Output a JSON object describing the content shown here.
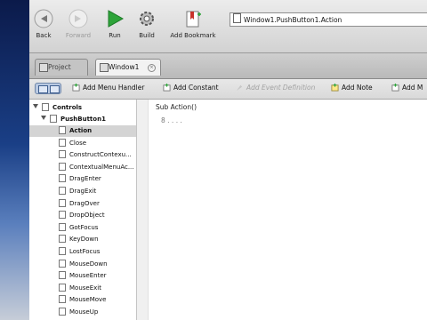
{
  "toolbar": {
    "back_label": "Back",
    "forward_label": "Forward",
    "run_label": "Run",
    "build_label": "Build",
    "add_bookmark_label": "Add Bookmark",
    "location_path": "Window1.PushButton1.Action"
  },
  "tabs": [
    {
      "label": "Project",
      "active": false
    },
    {
      "label": "Window1",
      "active": true
    }
  ],
  "actions": {
    "add_menu_handler": "Add Menu Handler",
    "add_constant": "Add Constant",
    "add_event_definition": "Add Event Definition",
    "add_note": "Add Note",
    "add_m": "Add M"
  },
  "sidebar": {
    "controls_label": "Controls",
    "pushbutton_label": "PushButton1",
    "events": [
      "Action",
      "Close",
      "ConstructContexu...",
      "ContextualMenuAc...",
      "DragEnter",
      "DragExit",
      "DragOver",
      "DropObject",
      "GotFocus",
      "KeyDown",
      "LostFocus",
      "MouseDown",
      "MouseEnter",
      "MouseExit",
      "MouseMove",
      "MouseUp"
    ],
    "selected_event": "Action"
  },
  "editor": {
    "header": "Sub Action()",
    "line1": "8 . . . ."
  },
  "colors": {
    "run_green": "#2ea43a",
    "bookmark_red": "#c8322a",
    "selected_row": "#d4d4d4"
  }
}
